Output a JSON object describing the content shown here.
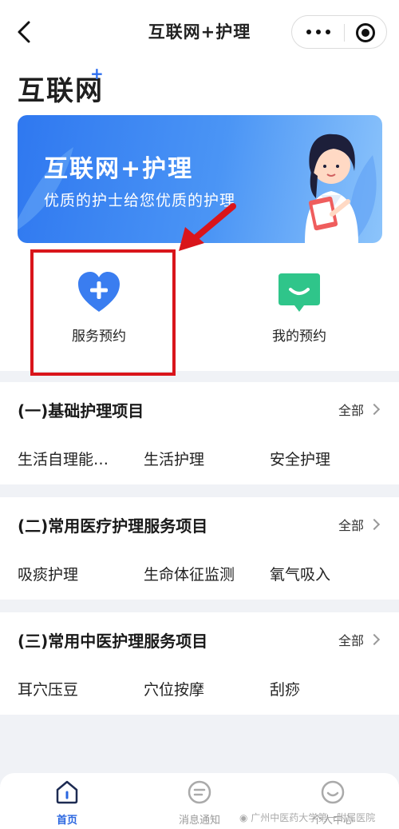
{
  "navbar": {
    "title": "互联网+护理"
  },
  "brand": {
    "title": "互联网",
    "plus": "+"
  },
  "banner": {
    "title": "互联网+护理",
    "subtitle": "优质的护士给您优质的护理"
  },
  "services": [
    {
      "label": "服务预约",
      "icon": "heart-plus-icon",
      "color": "#3a7df0"
    },
    {
      "label": "我的预约",
      "icon": "smile-chat-icon",
      "color": "#2fc58a"
    }
  ],
  "categories": [
    {
      "title": "(一)基础护理项目",
      "all": "全部",
      "items": [
        "生活自理能…",
        "生活护理",
        "安全护理"
      ]
    },
    {
      "title": "(二)常用医疗护理服务项目",
      "all": "全部",
      "items": [
        "吸痰护理",
        "生命体征监测",
        "氧气吸入"
      ]
    },
    {
      "title": "(三)常用中医护理服务项目",
      "all": "全部",
      "items": [
        "耳穴压豆",
        "穴位按摩",
        "刮痧"
      ]
    }
  ],
  "tabbar": [
    {
      "label": "首页",
      "icon": "home-icon",
      "active": true
    },
    {
      "label": "消息通知",
      "icon": "message-icon",
      "active": false
    },
    {
      "label": "个人中心",
      "icon": "profile-icon",
      "active": false
    }
  ],
  "watermark": "广州中医药大学第一附属医院",
  "colors": {
    "primary": "#2e6ff0",
    "highlight": "#d9151b",
    "green": "#2fc58a"
  }
}
